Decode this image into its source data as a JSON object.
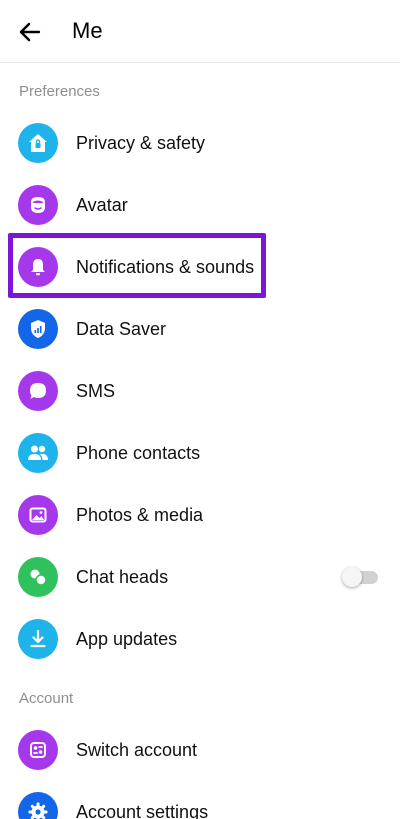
{
  "header": {
    "back_icon": "arrow-left-icon",
    "title": "Me"
  },
  "sections": [
    {
      "label": "Preferences"
    },
    {
      "label": "Account"
    }
  ],
  "items": [
    {
      "label": "Privacy & safety",
      "icon": "privacy-home-icon",
      "color": "#1fb3ec"
    },
    {
      "label": "Avatar",
      "icon": "avatar-face-icon",
      "color": "#a638ec"
    },
    {
      "label": "Notifications & sounds",
      "icon": "bell-icon",
      "color": "#a638ec",
      "highlighted": true
    },
    {
      "label": "Data Saver",
      "icon": "shield-signal-icon",
      "color": "#1466e8"
    },
    {
      "label": "SMS",
      "icon": "chat-bubble-icon",
      "color": "#a638ec"
    },
    {
      "label": "Phone contacts",
      "icon": "people-icon",
      "color": "#1fb3ec"
    },
    {
      "label": "Photos & media",
      "icon": "photo-icon",
      "color": "#a638ec"
    },
    {
      "label": "Chat heads",
      "icon": "chat-heads-icon",
      "color": "#2fc25c",
      "toggle": false
    },
    {
      "label": "App updates",
      "icon": "download-icon",
      "color": "#1fb3ec"
    },
    {
      "label": "Switch account",
      "icon": "switch-account-icon",
      "color": "#a638ec"
    },
    {
      "label": "Account settings",
      "icon": "gear-icon",
      "color": "#1466e8"
    }
  ],
  "colors": {
    "highlight": "#7b16d6",
    "section_text": "#8e8e8e"
  }
}
